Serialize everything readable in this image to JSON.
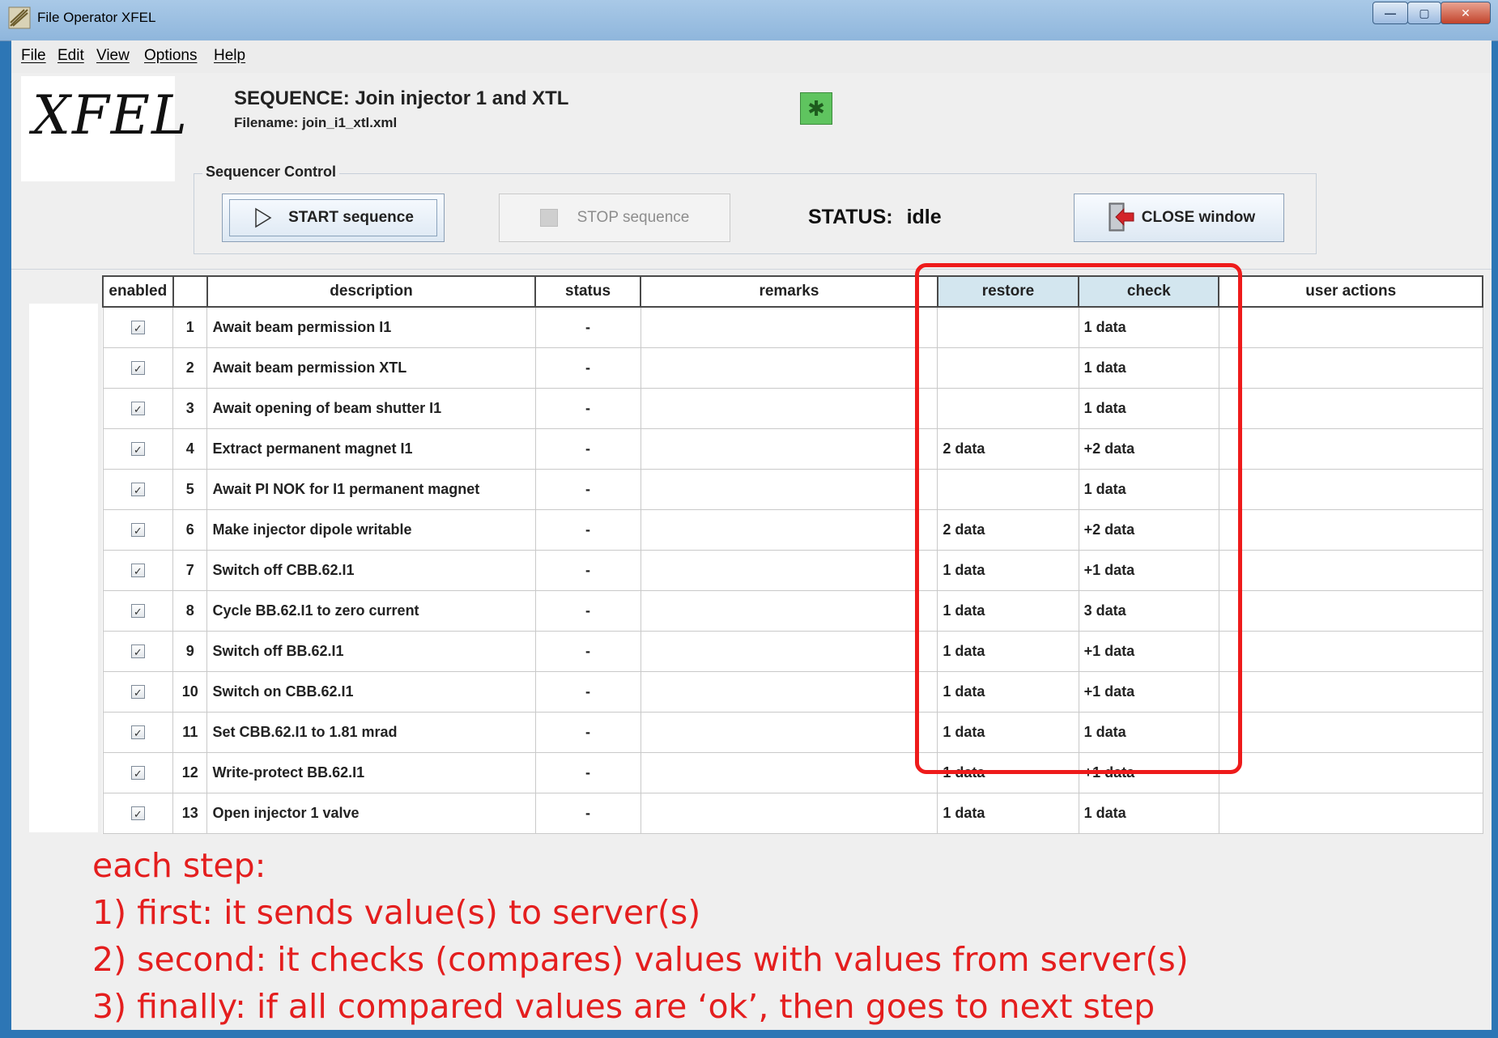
{
  "window": {
    "title": "File Operator XFEL",
    "min_glyph": "—",
    "max_glyph": "▢",
    "close_glyph": "✕"
  },
  "menu": [
    {
      "label": "File"
    },
    {
      "label": "Edit"
    },
    {
      "label": "View"
    },
    {
      "label": "Options"
    },
    {
      "label": "Help"
    }
  ],
  "header": {
    "logo_text": "XFEL",
    "sequence_title": "SEQUENCE: Join injector 1 and XTL",
    "filename": "Filename: join_i1_xtl.xml",
    "bug_icon": "green-bug-icon"
  },
  "sequencer_control": {
    "label": "Sequencer Control",
    "start_label": "START sequence",
    "stop_label": "STOP sequence",
    "status_label": "STATUS:",
    "status_value": "idle",
    "close_label": "CLOSE window"
  },
  "table": {
    "columns": [
      "enabled",
      "",
      "description",
      "status",
      "remarks",
      "restore",
      "check",
      "user actions"
    ],
    "rows": [
      {
        "num": "1",
        "description": "Await beam permission I1",
        "status": "-",
        "remarks": "",
        "restore": "",
        "check": "1 data",
        "user_actions": ""
      },
      {
        "num": "2",
        "description": "Await beam permission XTL",
        "status": "-",
        "remarks": "",
        "restore": "",
        "check": "1 data",
        "user_actions": ""
      },
      {
        "num": "3",
        "description": "Await opening of beam shutter I1",
        "status": "-",
        "remarks": "",
        "restore": "",
        "check": "1 data",
        "user_actions": ""
      },
      {
        "num": "4",
        "description": "Extract permanent magnet I1",
        "status": "-",
        "remarks": "",
        "restore": "2 data",
        "check": "+2 data",
        "user_actions": ""
      },
      {
        "num": "5",
        "description": "Await PI NOK for I1 permanent magnet",
        "status": "-",
        "remarks": "",
        "restore": "",
        "check": "1 data",
        "user_actions": ""
      },
      {
        "num": "6",
        "description": "Make injector dipole writable",
        "status": "-",
        "remarks": "",
        "restore": "2 data",
        "check": "+2 data",
        "user_actions": ""
      },
      {
        "num": "7",
        "description": "Switch off CBB.62.I1",
        "status": "-",
        "remarks": "",
        "restore": "1 data",
        "check": "+1 data",
        "user_actions": ""
      },
      {
        "num": "8",
        "description": "Cycle BB.62.I1 to zero current",
        "status": "-",
        "remarks": "",
        "restore": "1 data",
        "check": "3 data",
        "user_actions": ""
      },
      {
        "num": "9",
        "description": "Switch off BB.62.I1",
        "status": "-",
        "remarks": "",
        "restore": "1 data",
        "check": "+1 data",
        "user_actions": ""
      },
      {
        "num": "10",
        "description": "Switch on CBB.62.I1",
        "status": "-",
        "remarks": "",
        "restore": "1 data",
        "check": "+1 data",
        "user_actions": ""
      },
      {
        "num": "11",
        "description": "Set CBB.62.I1 to 1.81 mrad",
        "status": "-",
        "remarks": "",
        "restore": "1 data",
        "check": "1 data",
        "user_actions": ""
      },
      {
        "num": "12",
        "description": "Write-protect BB.62.I1",
        "status": "-",
        "remarks": "",
        "restore": "1 data",
        "check": "+1 data",
        "user_actions": ""
      },
      {
        "num": "13",
        "description": "Open injector 1 valve",
        "status": "-",
        "remarks": "",
        "restore": "1 data",
        "check": "1 data",
        "user_actions": ""
      }
    ]
  },
  "annotation": {
    "color": "#e41e1e",
    "lines": [
      "each step:",
      "1)  first: it sends value(s) to server(s)",
      "2)  second: it checks (compares) values with values from server(s)",
      "3)  finally: if all compared values are ‘ok’, then goes to next step"
    ]
  }
}
